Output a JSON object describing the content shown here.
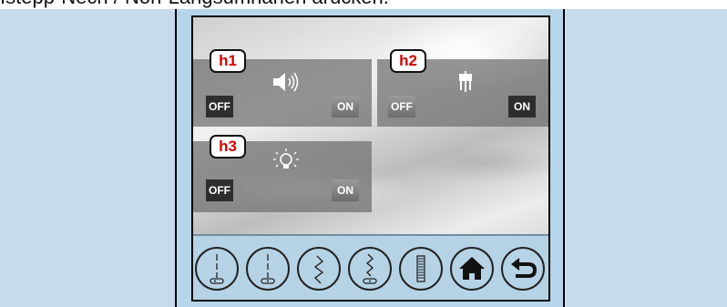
{
  "caption": "Istepp-Nech / Non-Längsumnahen ärücken.",
  "settings": [
    {
      "tag": "h1",
      "off_label": "OFF",
      "on_label": "ON",
      "icon": "speaker-icon"
    },
    {
      "tag": "h2",
      "off_label": "OFF",
      "on_label": "ON",
      "icon": "needle-threader-icon"
    },
    {
      "tag": "h3",
      "off_label": "OFF",
      "on_label": "ON",
      "icon": "light-bulb-icon"
    }
  ],
  "bottom_buttons": [
    {
      "icon": "presser-foot-left-icon"
    },
    {
      "icon": "presser-foot-center-icon"
    },
    {
      "icon": "zigzag-stitch-icon"
    },
    {
      "icon": "zigzag-foot-icon"
    },
    {
      "icon": "buttonhole-icon"
    },
    {
      "icon": "home-icon"
    },
    {
      "icon": "back-arrow-icon"
    }
  ]
}
